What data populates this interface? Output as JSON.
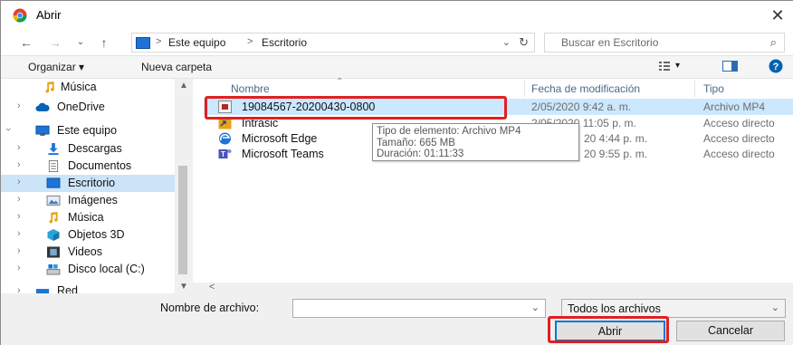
{
  "window": {
    "title": "Abrir",
    "close_glyph": "✕"
  },
  "address_bar": {
    "path": [
      "Este equipo",
      "Escritorio"
    ],
    "separator": ">",
    "search_placeholder": "Buscar en Escritorio"
  },
  "toolbar": {
    "organize_label": "Organizar ▾",
    "new_folder_label": "Nueva carpeta",
    "help_glyph": "?"
  },
  "nav_pane": {
    "items": [
      {
        "label": "Música",
        "icon": "music-note-icon"
      },
      {
        "label": "OneDrive",
        "icon": "cloud-icon"
      },
      {
        "label": "Este equipo",
        "icon": "computer-icon"
      },
      {
        "label": "Descargas",
        "icon": "download-arrow-icon"
      },
      {
        "label": "Documentos",
        "icon": "document-icon"
      },
      {
        "label": "Escritorio",
        "icon": "desktop-icon",
        "selected": true
      },
      {
        "label": "Imágenes",
        "icon": "pictures-icon"
      },
      {
        "label": "Música",
        "icon": "music-note-icon"
      },
      {
        "label": "Objetos 3D",
        "icon": "cube-3d-icon"
      },
      {
        "label": "Videos",
        "icon": "film-icon"
      },
      {
        "label": "Disco local (C:)",
        "icon": "drive-icon"
      },
      {
        "label": "Red",
        "icon": "network-icon"
      }
    ]
  },
  "file_list": {
    "columns": [
      "Nombre",
      "Fecha de modificación",
      "Tipo"
    ],
    "rows": [
      {
        "name": "19084567-20200430-0800",
        "date": "2/05/2020 9:42 a. m.",
        "type": "Archivo MP4",
        "icon": "video-file-icon",
        "selected": true
      },
      {
        "name": "Intrasic",
        "date": "2/05/2020 11:05 p. m.",
        "type": "Acceso directo",
        "icon": "shortcut-icon"
      },
      {
        "name": "Microsoft Edge",
        "date": "20 4:44 p. m.",
        "type": "Acceso directo",
        "icon": "edge-icon"
      },
      {
        "name": "Microsoft Teams",
        "date": "20 9:55 p. m.",
        "type": "Acceso directo",
        "icon": "teams-icon"
      }
    ]
  },
  "tooltip": {
    "lines": [
      "Tipo de elemento: Archivo MP4",
      "Tamaño: 665 MB",
      "Duración: 01:11:33"
    ]
  },
  "footer": {
    "filename_label": "Nombre de archivo:",
    "filename_value": "",
    "filter_value": "Todos los archivos",
    "open_label": "Abrir",
    "cancel_label": "Cancelar"
  },
  "colors": {
    "highlight_red": "#e02020",
    "selection_blue": "#cce8ff",
    "accent_blue": "#0078d7"
  }
}
